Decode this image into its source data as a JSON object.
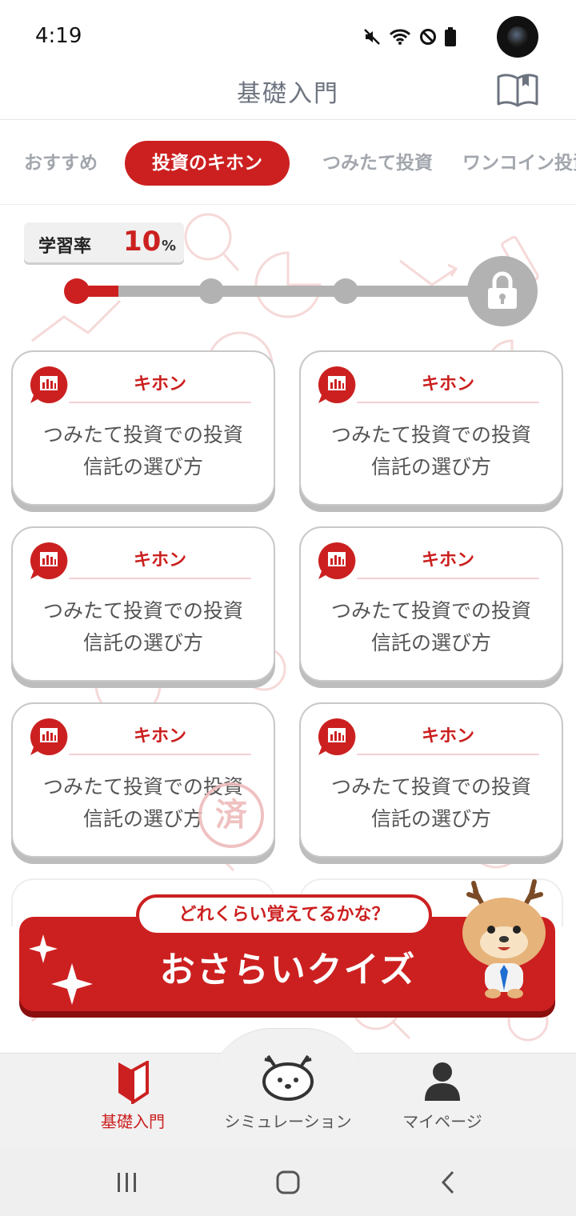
{
  "status_bar": {
    "time": "4:19"
  },
  "header": {
    "title": "基礎入門",
    "icon": "book-icon"
  },
  "tabs": [
    {
      "label": "おすすめ",
      "active": false
    },
    {
      "label": "投資のキホン",
      "active": true
    },
    {
      "label": "つみたて投資",
      "active": false
    },
    {
      "label": "ワンコイン投資",
      "active": false
    }
  ],
  "progress": {
    "label": "学習率",
    "value": "10",
    "unit": "%",
    "fraction": 0.1,
    "steps": 4,
    "completed_steps": 1,
    "final_step_locked": true
  },
  "cards": [
    {
      "tag": "キホン",
      "title_line1": "つみたて投資での投資",
      "title_line2": "信託の選び方",
      "completed": false
    },
    {
      "tag": "キホン",
      "title_line1": "つみたて投資での投資",
      "title_line2": "信託の選び方",
      "completed": false
    },
    {
      "tag": "キホン",
      "title_line1": "つみたて投資での投資",
      "title_line2": "信託の選び方",
      "completed": false
    },
    {
      "tag": "キホン",
      "title_line1": "つみたて投資での投資",
      "title_line2": "信託の選び方",
      "completed": false
    },
    {
      "tag": "キホン",
      "title_line1": "つみたて投資での投資",
      "title_line2": "信託の選び方",
      "completed": true
    },
    {
      "tag": "キホン",
      "title_line1": "つみたて投資での投資",
      "title_line2": "信託の選び方",
      "completed": false
    }
  ],
  "stamp_text": "済",
  "quiz_banner": {
    "subtitle": "どれくらい覚えてるかな？",
    "title": "おさらいクイズ"
  },
  "bottom_nav": [
    {
      "label": "基礎入門",
      "icon": "beginner-mark-icon",
      "active": true
    },
    {
      "label": "シミュレーション",
      "icon": "deer-mascot-icon",
      "active": false
    },
    {
      "label": "マイページ",
      "icon": "person-icon",
      "active": false
    }
  ],
  "colors": {
    "accent": "#cc2020",
    "muted": "#b2b2b2",
    "tab_inactive": "#a2a6ad"
  }
}
